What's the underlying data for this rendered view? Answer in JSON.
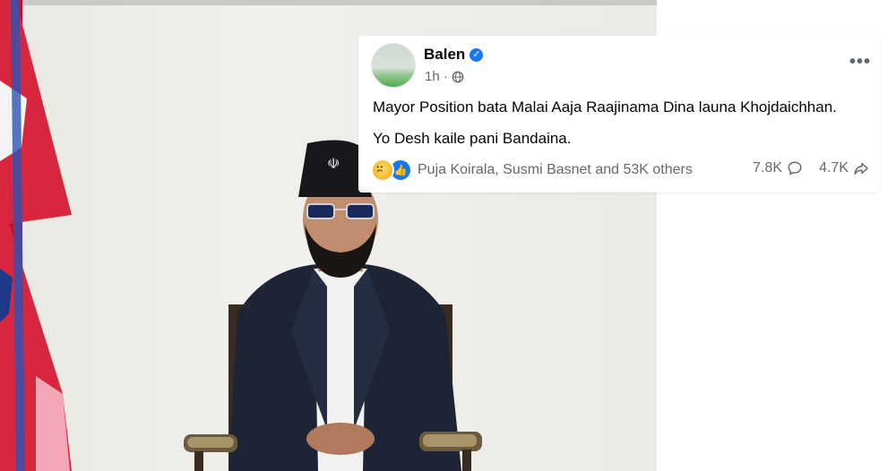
{
  "post": {
    "author": "Balen",
    "time": "1h",
    "line1": "Mayor Position bata Malai Aaja Raajinama Dina launa Khojdaichhan.",
    "line2": "Yo Desh kaile pani Bandaina.",
    "reactions_text": "Puja Koirala, Susmi Basnet and 53K others",
    "comments_count": "7.8K",
    "shares_count": "4.7K",
    "reaction_icons": [
      "sad-reaction",
      "like-reaction"
    ],
    "accent_color": "#1877f2"
  }
}
